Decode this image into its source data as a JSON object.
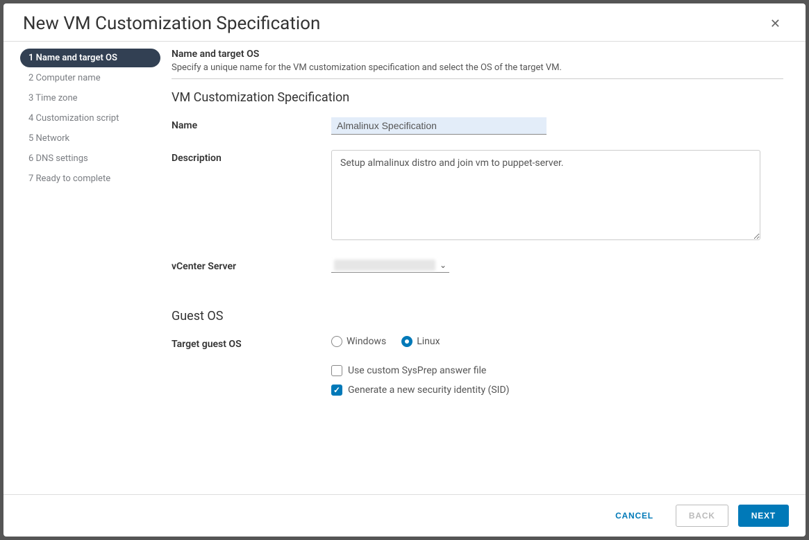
{
  "modal_title": "New VM Customization Specification",
  "steps": [
    "1 Name and target OS",
    "2 Computer name",
    "3 Time zone",
    "4 Customization script",
    "5 Network",
    "6 DNS settings",
    "7 Ready to complete"
  ],
  "section": {
    "title": "Name and target OS",
    "desc": "Specify a unique name for the VM customization specification and select the OS of the target VM."
  },
  "spec_heading": "VM Customization Specification",
  "labels": {
    "name": "Name",
    "description": "Description",
    "vcenter": "vCenter Server",
    "guest_os_heading": "Guest OS",
    "target_guest_os": "Target guest OS"
  },
  "form": {
    "name_value": "Almalinux Specification",
    "description_value": "Setup almalinux distro and join vm to puppet-server.",
    "vcenter_value": ""
  },
  "target_os": {
    "windows": "Windows",
    "linux": "Linux",
    "selected": "Linux"
  },
  "checkboxes": {
    "sysprep_label": "Use custom SysPrep answer file",
    "sysprep_checked": false,
    "sid_label": "Generate a new security identity (SID)",
    "sid_checked": true
  },
  "footer": {
    "cancel": "CANCEL",
    "back": "BACK",
    "next": "NEXT"
  }
}
